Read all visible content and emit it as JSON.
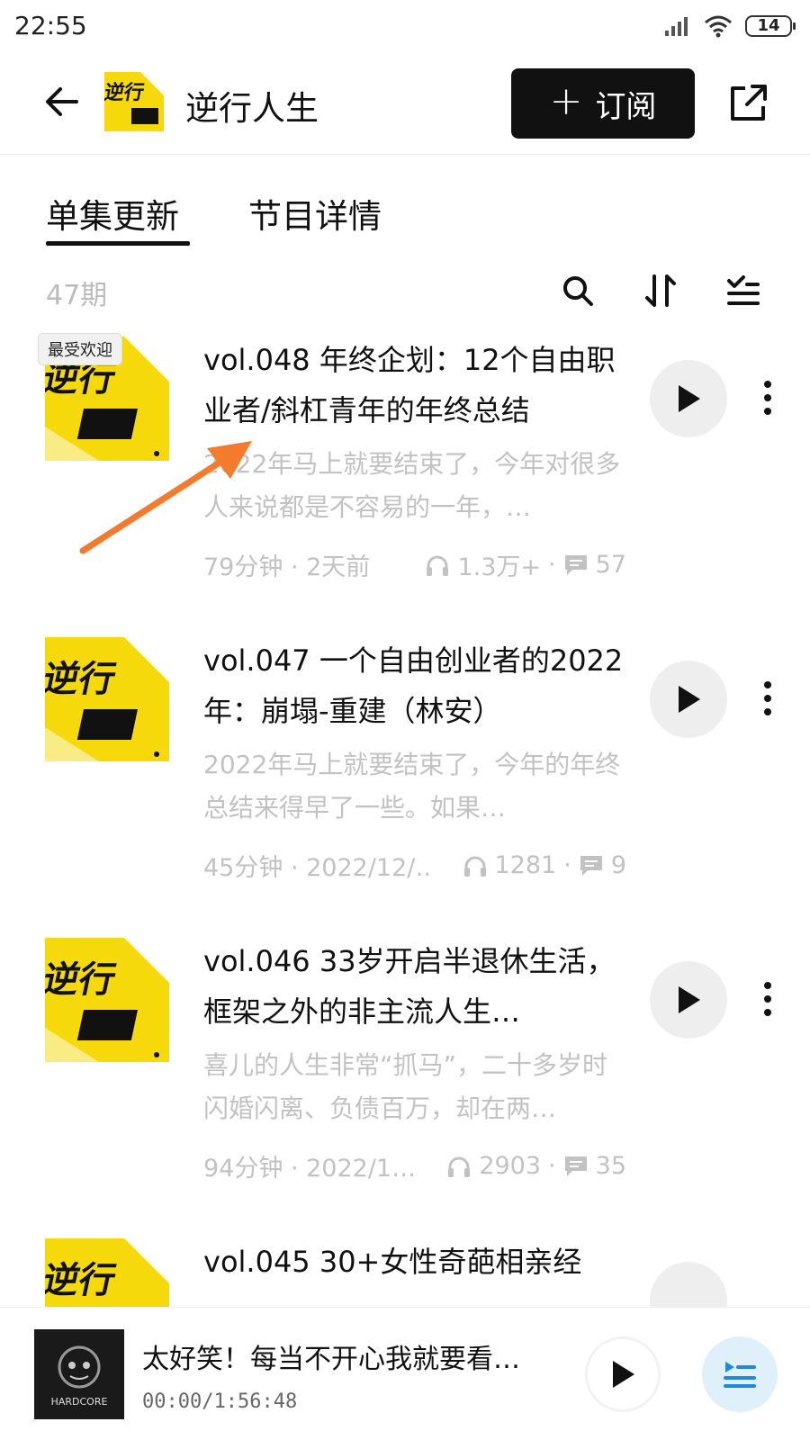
{
  "status_bar": {
    "time": "22:55",
    "battery": "14"
  },
  "header": {
    "title": "逆行人生",
    "subscribe_label": "订阅",
    "cover_text": "逆行"
  },
  "tabs": [
    {
      "label": "单集更新",
      "active": true
    },
    {
      "label": "节目详情",
      "active": false
    }
  ],
  "toolbar": {
    "count": "47期"
  },
  "episodes": [
    {
      "badge": "最受欢迎",
      "title": "vol.048 年终企划：12个自由职业者/斜杠青年的年终总结",
      "desc": "2022年马上就要结束了，今年对很多人来说都是不容易的一年，…",
      "time": "79分钟 · 2天前",
      "listens": "1.3万+",
      "comments": "57"
    },
    {
      "title": "vol.047 一个自由创业者的2022年：崩塌-重建（林安）",
      "desc": "2022年马上就要结束了，今年的年终总结来得早了一些。如果…",
      "time": "45分钟 · 2022/12/…",
      "listens": "1281",
      "comments": "9"
    },
    {
      "title": "vol.046 33岁开启半退休生活，框架之外的非主流人生…",
      "desc": "喜儿的人生非常“抓马”，二十多岁时闪婚闪离、负债百万，却在两…",
      "time": "94分钟 · 2022/1…",
      "listens": "2903",
      "comments": "35"
    },
    {
      "title": "vol.045 30+女性奇葩相亲经"
    }
  ],
  "player": {
    "title": "太好笑！每当不开心我就要看…",
    "time": "00:00/1:56:48",
    "cover_text": "HARDCORE"
  },
  "colors": {
    "brand_yellow": "#f5d90a",
    "annotation_arrow": "#f47a2e"
  }
}
